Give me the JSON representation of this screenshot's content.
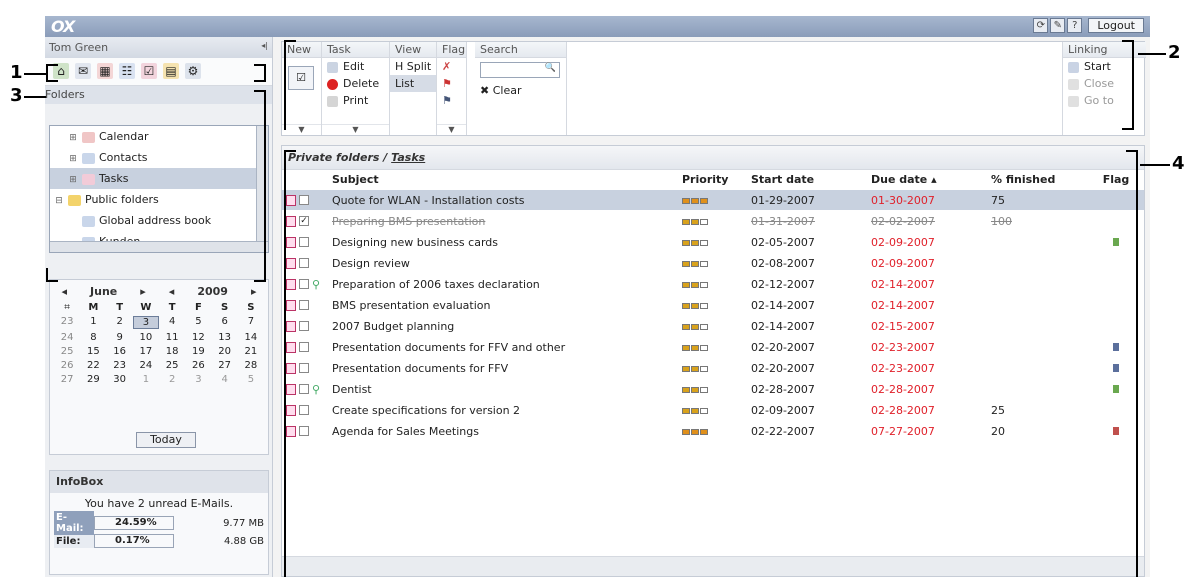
{
  "app": {
    "logo": "OX",
    "logout_label": "Logout"
  },
  "sidebar": {
    "user": "Tom Green",
    "collapse_glyph": "◂|",
    "folders_label": "Folders",
    "tree": [
      {
        "label": "Calendar",
        "indent": 1,
        "expander": "⊞",
        "selected": false,
        "icon": "calendar-folder-icon"
      },
      {
        "label": "Contacts",
        "indent": 1,
        "expander": "⊞",
        "selected": false,
        "icon": "contacts-folder-icon"
      },
      {
        "label": "Tasks",
        "indent": 1,
        "expander": "⊞",
        "selected": true,
        "icon": "tasks-folder-icon"
      },
      {
        "label": "Public folders",
        "indent": 0,
        "expander": "⊟",
        "selected": false,
        "icon": "public-folder-icon"
      },
      {
        "label": "Global address book",
        "indent": 1,
        "expander": "",
        "selected": false,
        "icon": "address-book-icon"
      },
      {
        "label": "Kunden",
        "indent": 1,
        "expander": "",
        "selected": false,
        "icon": "contacts-folder-icon"
      }
    ]
  },
  "calendar": {
    "month": "June",
    "year": "2009",
    "prev": "◂",
    "next": "▸",
    "weekdays": [
      "M",
      "T",
      "W",
      "T",
      "F",
      "S",
      "S"
    ],
    "weeks": [
      {
        "wk": "23",
        "days": [
          "1",
          "2",
          "3",
          "4",
          "5",
          "6",
          "7"
        ]
      },
      {
        "wk": "24",
        "days": [
          "8",
          "9",
          "10",
          "11",
          "12",
          "13",
          "14"
        ]
      },
      {
        "wk": "25",
        "days": [
          "15",
          "16",
          "17",
          "18",
          "19",
          "20",
          "21"
        ]
      },
      {
        "wk": "26",
        "days": [
          "22",
          "23",
          "24",
          "25",
          "26",
          "27",
          "28"
        ]
      },
      {
        "wk": "27",
        "days": [
          "29",
          "30",
          "1",
          "2",
          "3",
          "4",
          "5"
        ]
      }
    ],
    "today_label": "Today",
    "selected_day": "3"
  },
  "infobox": {
    "title": "InfoBox",
    "message": "You have 2 unread E-Mails.",
    "email_label": "E-Mail:",
    "email_pct": "24.59%",
    "email_size": "9.77 MB",
    "file_label": "File:",
    "file_pct": "0.17%",
    "file_size": "4.88 GB"
  },
  "toolbar": {
    "new": "New",
    "task": "Task",
    "edit": "Edit",
    "delete": "Delete",
    "print": "Print",
    "view": "View",
    "hsplit": "H Split",
    "list": "List",
    "flag": "Flag",
    "search": "Search",
    "clear": "Clear",
    "linking": "Linking",
    "start": "Start",
    "close": "Close",
    "goto": "Go to"
  },
  "list": {
    "path_prefix": "Private folders / ",
    "path_folder": "Tasks",
    "columns": {
      "subject": "Subject",
      "priority": "Priority",
      "start": "Start date",
      "due": "Due date ▴",
      "pct": "% finished",
      "flag": "Flag"
    },
    "rows": [
      {
        "subject": "Quote for WLAN - Installation costs",
        "start": "01-29-2007",
        "due": "01-30-2007",
        "pct": "75",
        "done": false,
        "selected": true,
        "priority": 3,
        "linked": false,
        "flag": ""
      },
      {
        "subject": "Preparing BMS presentation",
        "start": "01-31-2007",
        "due": "02-02-2007",
        "pct": "100",
        "done": true,
        "selected": false,
        "priority": 2,
        "linked": false,
        "flag": ""
      },
      {
        "subject": "Designing new business cards",
        "start": "02-05-2007",
        "due": "02-09-2007",
        "pct": "",
        "done": false,
        "selected": false,
        "priority": 2,
        "linked": false,
        "flag": "#6aa84f"
      },
      {
        "subject": "Design review",
        "start": "02-08-2007",
        "due": "02-09-2007",
        "pct": "",
        "done": false,
        "selected": false,
        "priority": 2,
        "linked": false,
        "flag": ""
      },
      {
        "subject": "Preparation of 2006 taxes declaration",
        "start": "02-12-2007",
        "due": "02-14-2007",
        "pct": "",
        "done": false,
        "selected": false,
        "priority": 2,
        "linked": true,
        "flag": ""
      },
      {
        "subject": "BMS presentation evaluation",
        "start": "02-14-2007",
        "due": "02-14-2007",
        "pct": "",
        "done": false,
        "selected": false,
        "priority": 2,
        "linked": false,
        "flag": ""
      },
      {
        "subject": "2007 Budget planning",
        "start": "02-14-2007",
        "due": "02-15-2007",
        "pct": "",
        "done": false,
        "selected": false,
        "priority": 2,
        "linked": false,
        "flag": ""
      },
      {
        "subject": "Presentation documents for FFV and other",
        "start": "02-20-2007",
        "due": "02-23-2007",
        "pct": "",
        "done": false,
        "selected": false,
        "priority": 2,
        "linked": false,
        "flag": "#5b6f9c"
      },
      {
        "subject": "Presentation documents for FFV",
        "start": "02-20-2007",
        "due": "02-23-2007",
        "pct": "",
        "done": false,
        "selected": false,
        "priority": 2,
        "linked": false,
        "flag": "#5b6f9c"
      },
      {
        "subject": "Dentist",
        "start": "02-28-2007",
        "due": "02-28-2007",
        "pct": "",
        "done": false,
        "selected": false,
        "priority": 2,
        "linked": true,
        "flag": "#6aa84f"
      },
      {
        "subject": "Create specifications for version 2",
        "start": "02-09-2007",
        "due": "02-28-2007",
        "pct": "25",
        "done": false,
        "selected": false,
        "priority": 2,
        "linked": false,
        "flag": ""
      },
      {
        "subject": "Agenda for Sales Meetings",
        "start": "02-22-2007",
        "due": "07-27-2007",
        "pct": "20",
        "done": false,
        "selected": false,
        "priority": 3,
        "linked": false,
        "flag": "#c0504d"
      }
    ]
  },
  "callouts": {
    "c1": "1",
    "c2": "2",
    "c3": "3",
    "c4": "4"
  }
}
